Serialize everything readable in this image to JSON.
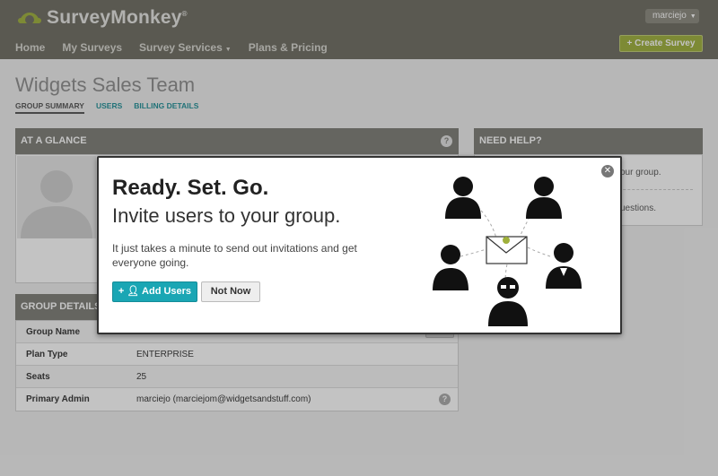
{
  "app": {
    "brand": "SurveyMonkey",
    "reg": "®",
    "user": "marciejo",
    "create_label": "+ Create Survey"
  },
  "nav": {
    "items": [
      "Home",
      "My Surveys",
      "Survey Services",
      "Plans & Pricing"
    ]
  },
  "page": {
    "title": "Widgets Sales Team",
    "tabs": [
      "GROUP SUMMARY",
      "USERS",
      "BILLING DETAILS"
    ]
  },
  "glance": {
    "title": "AT A GLANCE"
  },
  "help": {
    "title": "NEED HELP?",
    "line1": "our group.",
    "line2": "uestions."
  },
  "details": {
    "title": "GROUP DETAILS",
    "rows": [
      {
        "key": "Group Name",
        "value": ""
      },
      {
        "key": "Plan Type",
        "value": "ENTERPRISE"
      },
      {
        "key": "Seats",
        "value": "25"
      },
      {
        "key": "Primary Admin",
        "value": "marciejo (marciejom@widgetsandstuff.com)"
      }
    ]
  },
  "modal": {
    "title": "Ready. Set. Go.",
    "subtitle": "Invite users to your group.",
    "description": "It just takes a minute to send out invitations and get everyone going.",
    "add_label": "Add Users",
    "not_now_label": "Not Now"
  },
  "colors": {
    "header": "#6e6c62",
    "accent": "#1aa6b4",
    "create": "#9fb03b",
    "link": "#1f8f97"
  }
}
